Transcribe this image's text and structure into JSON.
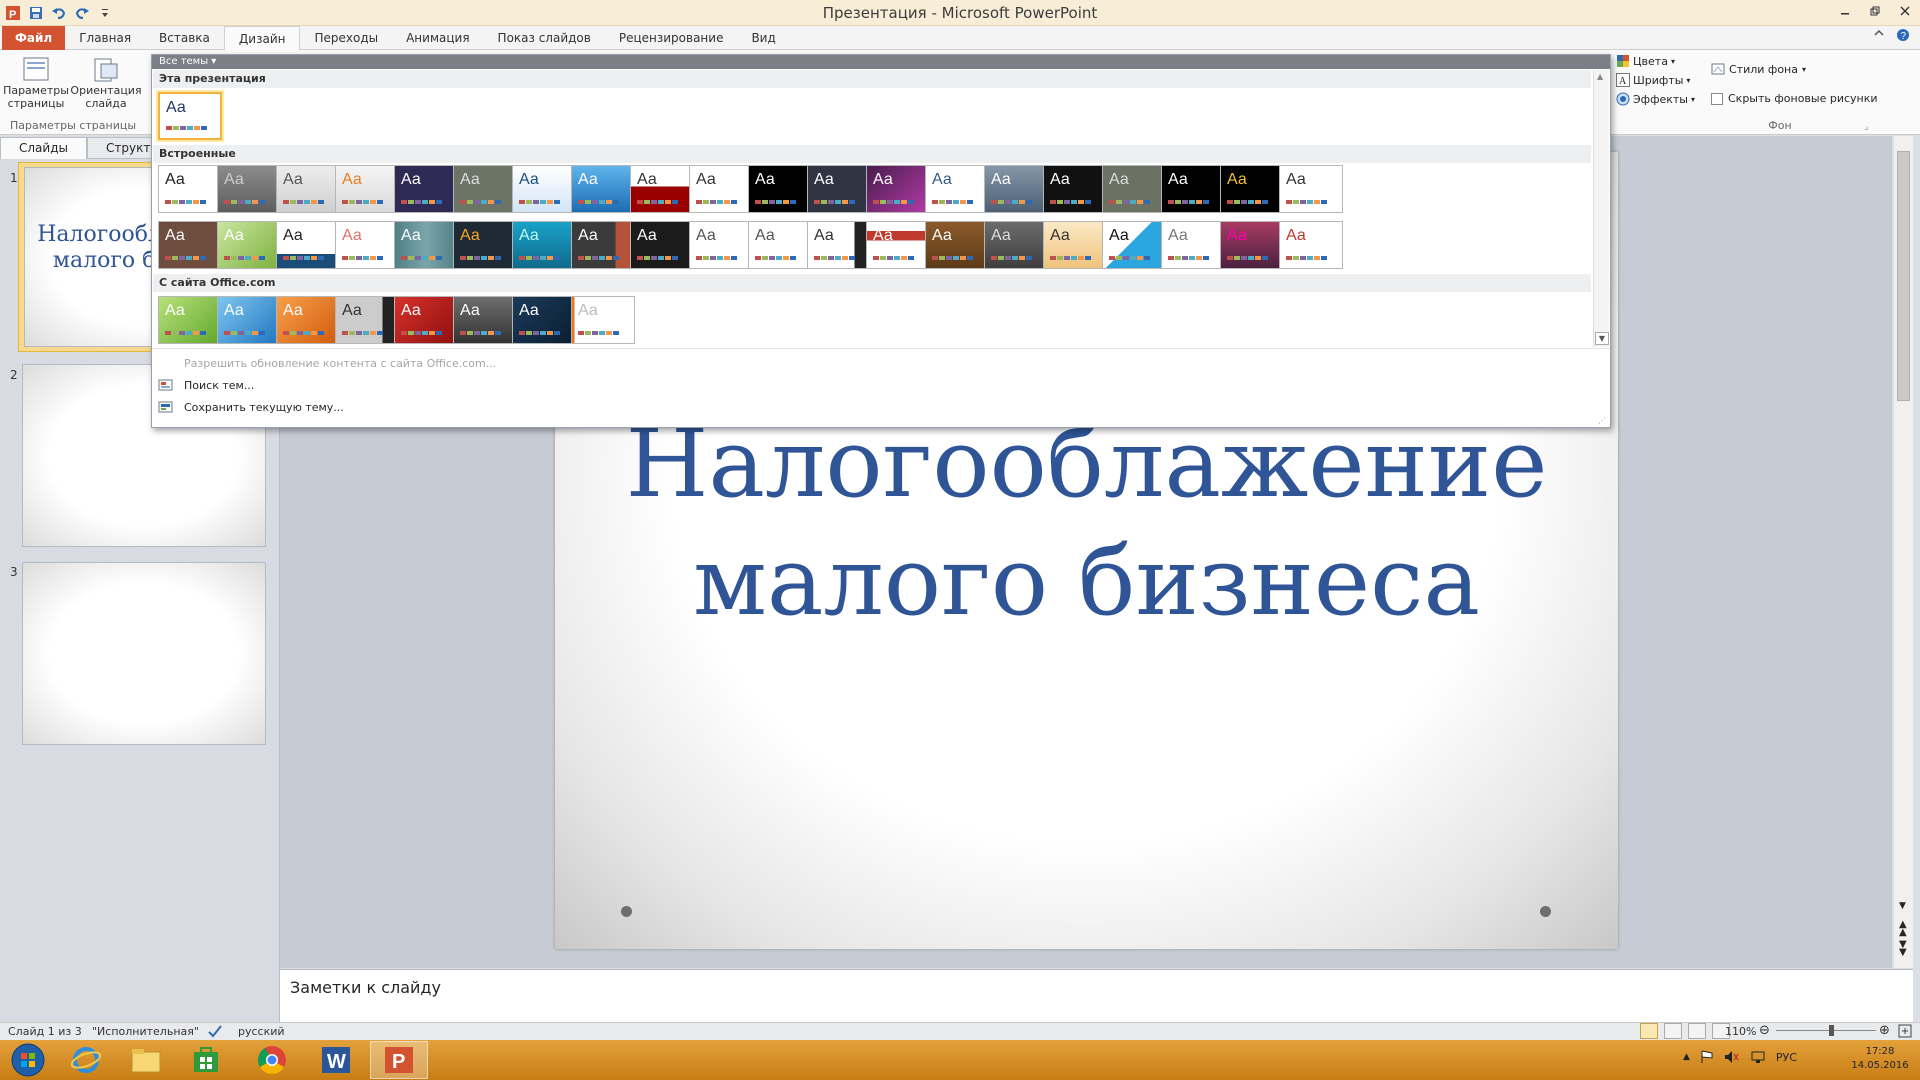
{
  "window": {
    "title": "Презентация  -  Microsoft PowerPoint",
    "app_icon": "powerpoint-icon",
    "quick_access": [
      "save-icon",
      "undo-icon",
      "redo-icon",
      "customize-icon"
    ],
    "controls": [
      "minimize-icon",
      "restore-icon",
      "close-icon"
    ]
  },
  "tabs": [
    {
      "label": "Файл",
      "kind": "file"
    },
    {
      "label": "Главная"
    },
    {
      "label": "Вставка"
    },
    {
      "label": "Дизайн",
      "active": true
    },
    {
      "label": "Переходы"
    },
    {
      "label": "Анимация"
    },
    {
      "label": "Показ слайдов"
    },
    {
      "label": "Рецензирование"
    },
    {
      "label": "Вид"
    }
  ],
  "ribbon": {
    "page_setup": {
      "page_params": "Параметры\nстраницы",
      "orientation": "Ориентация\nслайда",
      "group_label": "Параметры страницы"
    },
    "theme_options": {
      "colors": "Цвета",
      "fonts": "Шрифты",
      "effects": "Эффекты"
    },
    "background": {
      "styles": "Стили фона",
      "hide_graphics": "Скрыть фоновые рисунки",
      "hide_graphics_checked": false,
      "group_label": "Фон"
    }
  },
  "gallery": {
    "header": "Все темы",
    "sections": {
      "this_presentation": "Эта презентация",
      "builtin": "Встроенные",
      "office_com": "С сайта Office.com"
    },
    "aa": "Аа",
    "menu": {
      "allow_update": "Разрешить обновление контента с сайта Office.com...",
      "search": "Поиск тем...",
      "save": "Сохранить текущую тему..."
    }
  },
  "slides_panel": {
    "tab_slides": "Слайды",
    "tab_outline": "Структура",
    "thumbs": [
      {
        "num": "1",
        "text": "Налогооблажение\nмалого бизнеса",
        "selected": true
      },
      {
        "num": "2",
        "text": ""
      },
      {
        "num": "3",
        "text": ""
      }
    ]
  },
  "slide": {
    "title": "Налогооблажение малого бизнеса",
    "title_color": "#2f5597"
  },
  "notes": {
    "placeholder": "Заметки к слайду"
  },
  "status": {
    "slide_info": "Слайд 1 из 3",
    "theme": "\"Исполнительная\"",
    "language": "русский",
    "zoom": "110%",
    "zoom_level": 0.55
  },
  "taskbar": {
    "apps": [
      "windows-start-icon",
      "internet-explorer-icon",
      "file-explorer-icon",
      "store-icon",
      "chrome-icon",
      "word-icon",
      "powerpoint-icon"
    ],
    "lang": "РУС",
    "time": "17:28",
    "date": "14.05.2016"
  },
  "colors": {
    "accent": "#d35230",
    "title_blue": "#2f5597",
    "taskbar": "#d78f24"
  }
}
